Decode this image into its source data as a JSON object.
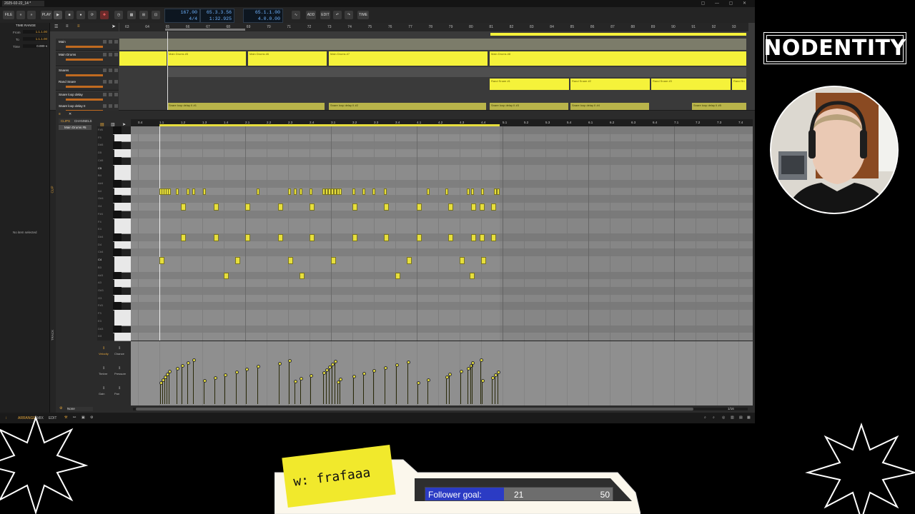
{
  "titlebar": {
    "project_tab": "2025-02-22_14 *"
  },
  "toolbar": {
    "file": "FILE",
    "play_label": "PLAY",
    "tempo": "167.00",
    "time_sig": "4/4",
    "position_bars": "65.3.3.56",
    "position_time": "1:32.925",
    "loop_start": "65.1.1.00",
    "loop_len": "4.0.0.00",
    "add": "ADD",
    "edit": "EDIT",
    "time": "TIME"
  },
  "inspector": {
    "section": "TIME RANGE",
    "from_label": "From",
    "from_value": "1.1.1.00",
    "to_label": "To",
    "to_value": "1.1.1.00",
    "time_label": "Time",
    "time_value": "0.000 s",
    "empty": "No item selected"
  },
  "arranger": {
    "ruler_bars": [
      "63",
      "64",
      "65",
      "66",
      "67",
      "68",
      "69",
      "70",
      "71",
      "72",
      "73",
      "74",
      "75",
      "76",
      "77",
      "78",
      "79",
      "80",
      "81",
      "82",
      "83",
      "84",
      "85",
      "86",
      "87",
      "88",
      "89",
      "90",
      "91",
      "92",
      "93"
    ],
    "tracks": [
      {
        "name": "Main"
      },
      {
        "name": "Main Drums"
      },
      {
        "name": "Snares"
      },
      {
        "name": "Rand Snare"
      },
      {
        "name": "Snare loop delay"
      },
      {
        "name": "Snare loop delay II"
      }
    ],
    "main_drum_clips": [
      "Main Drums #5",
      "Main Drums #6",
      "Main Drums #7",
      "Main Drums #8"
    ],
    "rand_snare_clips": [
      "Rand Snare #1",
      "Rand Snare #2",
      "Rand Snare #3",
      "Rand Sn"
    ],
    "snare_delay_clips": [
      "Snare loop delay II #1",
      "Snare loop delay II #2",
      "Snare loop delay II #3",
      "Snare loop delay II #4",
      "Snare loop delay II #5"
    ],
    "zoom": "1/4"
  },
  "editor": {
    "tab_clips": "CLIPS",
    "tab_channels": "CHANNELS",
    "clip_name": "Main Drums #5",
    "side_clip": "CLIP",
    "side_track": "TRACK",
    "ruler": [
      "0.4",
      "1.1",
      "1.2",
      "1.3",
      "1.4",
      "2.1",
      "2.2",
      "2.3",
      "2.4",
      "3.1",
      "3.2",
      "3.3",
      "3.4",
      "4.1",
      "4.2",
      "4.3",
      "4.4",
      "5.1",
      "5.2",
      "5.3",
      "5.4",
      "6.1",
      "6.2",
      "6.3",
      "6.4",
      "7.1",
      "7.2",
      "7.3",
      "7.4"
    ],
    "key_labels": [
      "F#5",
      "F5",
      "D#5",
      "D5",
      "C#5",
      "C5",
      "B4",
      "A#4",
      "A4",
      "G#4",
      "G4",
      "F#4",
      "F4",
      "E4",
      "D#4",
      "D4",
      "C#4",
      "C4",
      "B3",
      "A#3",
      "A3",
      "G#3",
      "G3",
      "F#3",
      "F3",
      "E3",
      "D#3",
      "D3"
    ],
    "lanes": [
      {
        "label": "Velocity"
      },
      {
        "label": "Chance"
      },
      {
        "label": "Timbre"
      },
      {
        "label": "Pressure"
      },
      {
        "label": "Gain"
      },
      {
        "label": "Pan"
      }
    ],
    "footer_none": "None",
    "zoom": "1/16"
  },
  "statusbar": {
    "arrange": "ARRANGE",
    "mix": "MIX",
    "edit": "EDIT"
  },
  "overlay": {
    "logo": "NODENTITY",
    "tag": "w: frafaaa",
    "goal_label": "Follower goal:",
    "goal_current": "21",
    "goal_max": "50",
    "goal_fraction": 0.42
  },
  "colors": {
    "clip": "#f5f23a",
    "accent": "#e2a43a",
    "goal_fill": "#2b3bc4",
    "tag": "#f1e92c"
  }
}
